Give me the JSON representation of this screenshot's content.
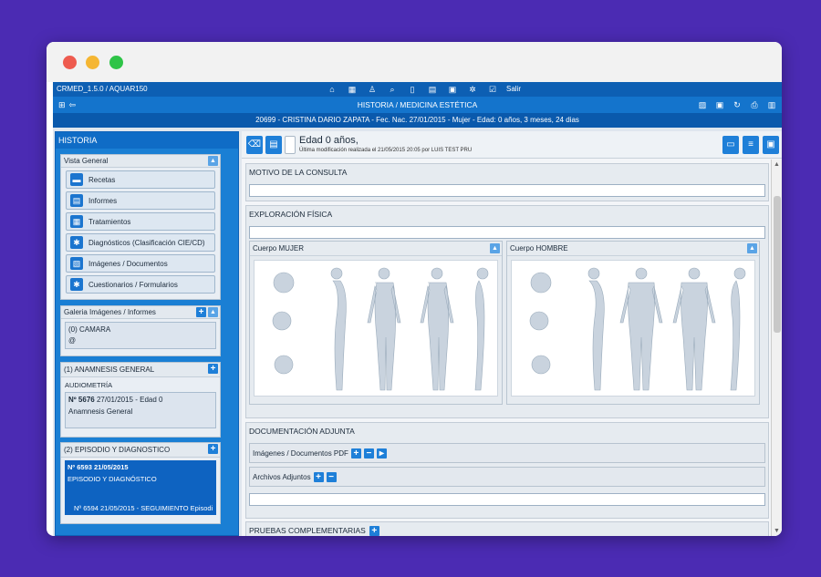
{
  "app": {
    "version": "CRMED_1.5.0 / AQUAR150",
    "salir": "Salir",
    "title": "HISTORIA / MEDICINA ESTÉTICA",
    "patient_line": "20699 - CRISTINA DARIO ZAPATA - Fec. Nac. 27/01/2015 - Mujer - Edad: 0 años, 3 meses, 24 dias"
  },
  "left": {
    "header": "HISTORIA",
    "vista_general": {
      "title": "Vista General",
      "items": [
        {
          "label": "Recetas"
        },
        {
          "label": "Informes"
        },
        {
          "label": "Tratamientos"
        },
        {
          "label": "Diagnósticos (Clasificación CIE/CD)"
        },
        {
          "label": "Imágenes / Documentos"
        },
        {
          "label": "Cuestionarios / Formularios"
        }
      ]
    },
    "galeria": {
      "title": "Galeria Imágenes / Informes",
      "line1": "(0) CAMARA",
      "line2": "@"
    },
    "anamnesis": {
      "title": "(1) ANAMNESIS GENERAL",
      "sub": "AUDIOMETRÍA",
      "num": "Nº 5676",
      "date": "27/01/2015 - Edad 0",
      "desc": "Anamnesis General"
    },
    "episodio": {
      "title": "(2) EPISODIO Y DIAGNOSTICO",
      "l1": "Nº 6593 21/05/2015",
      "l2": "EPISODIO Y DIAGNÓSTICO",
      "l3": "Nº 6594 21/05/2015 - SEGUIMIENTO Episodi"
    }
  },
  "main": {
    "edad": "Edad 0 años,",
    "modificacion": "Última modificación realizada el 21/05/2015 20:05 por LUIS TEST PRU",
    "motivo": "MOTIVO DE LA CONSULTA",
    "exploracion": "EXPLORACIÓN FÍSICA",
    "cuerpo_mujer": "Cuerpo MUJER",
    "cuerpo_hombre": "Cuerpo HOMBRE",
    "documentacion": "DOCUMENTACIÓN ADJUNTA",
    "imagenes_pdf": "Imágenes / Documentos PDF",
    "archivos": "Archivos Adjuntos",
    "pruebas": "PRUEBAS COMPLEMENTARIAS"
  },
  "colors": {
    "bg": "#4b2bb3",
    "brand": "#1474cc"
  }
}
